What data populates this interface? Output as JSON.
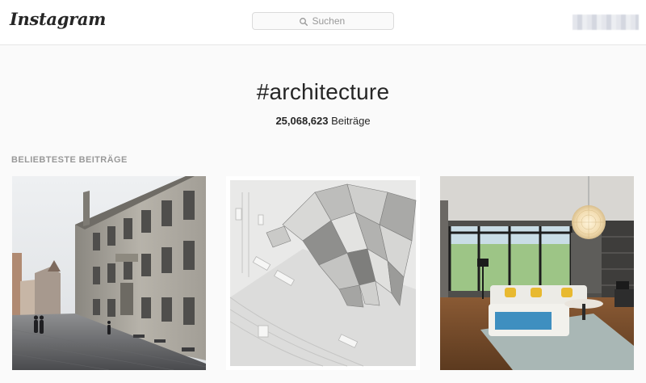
{
  "header": {
    "logo_text": "Instagram",
    "search_placeholder": "Suchen"
  },
  "hashtag": {
    "title": "#architecture",
    "post_count": "25,068,623",
    "post_count_label": "Beiträge"
  },
  "section": {
    "title": "BELIEBTESTE BEITRÄGE"
  },
  "posts": [
    {
      "subject": "old stone city hall building on a wet cobblestone street"
    },
    {
      "subject": "white architectural model with folded paper sculpture"
    },
    {
      "subject": "modern living room with glass wall and round pendant lamp"
    }
  ],
  "colors": {
    "background": "#fafafa",
    "header": "#ffffff",
    "text": "#262626",
    "muted": "#999999",
    "border": "#dbdbdb"
  }
}
